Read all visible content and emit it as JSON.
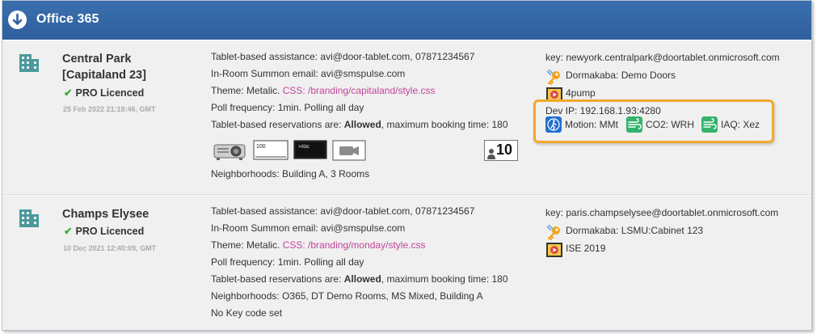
{
  "header": {
    "title": "Office 365"
  },
  "rooms": [
    {
      "name_line1": "Central Park",
      "name_line2": "[Capitaland 23]",
      "licence": "PRO Licenced",
      "timestamp": "25 Feb 2022 21:18:46, GMT",
      "assistance": "Tablet-based assistance: avi@door-tablet.com, 07871234567",
      "summon": "In-Room Summon email: avi@smspulse.com",
      "theme_prefix": "Theme: Metalic.",
      "theme_css": "CSS: /branding/capitaland/style.css",
      "poll": "Poll frequency: 1min. Polling all day",
      "reservations_prefix": "Tablet-based reservations are:",
      "reservations_status": "Allowed",
      "reservations_suffix": ", maximum booking time: 180",
      "capacity": "10",
      "neighborhoods": "Neighborhoods: Building A, 3 Rooms",
      "device_icons": [
        "projector-icon",
        "whiteboard-icon",
        "display-icon",
        "camera-icon"
      ],
      "key": "key: newyork.centralpark@doortablet.onmicrosoft.com",
      "lock": "Dormakaba: Demo Doors",
      "video": "4pump",
      "dev_ip": "Dev IP: 192.168.1.93:4280",
      "motion": "Motion: MMt",
      "co2": "CO2: WRH",
      "iaq": "IAQ: Xez"
    },
    {
      "name_line1": "Champs Elysee",
      "licence": "PRO Licenced",
      "timestamp": "10 Dec 2021 12:40:09, GMT",
      "assistance": "Tablet-based assistance: avi@door-tablet.com, 07871234567",
      "summon": "In-Room Summon email: avi@smspulse.com",
      "theme_prefix": "Theme: Metalic.",
      "theme_css": "CSS: /branding/monday/style.css",
      "poll": "Poll frequency: 1min. Polling all day",
      "reservations_prefix": "Tablet-based reservations are:",
      "reservations_status": "Allowed",
      "reservations_suffix": ", maximum booking time: 180",
      "neighborhoods": "Neighborhoods: O365, DT Demo Rooms, MS Mixed, Building A",
      "keycode": "No Key code set",
      "key": "key: paris.champselysee@doortablet.onmicrosoft.com",
      "lock": "Dormakaba: LSMU:Cabinet 123",
      "video": "ISE 2019"
    }
  ],
  "colors": {
    "header": "#3568a6",
    "highlight": "#f0a92a",
    "link": "#c2449b",
    "check": "#3cae3c",
    "sensor_blue": "#1f6fd0",
    "sensor_green": "#34b36b"
  }
}
